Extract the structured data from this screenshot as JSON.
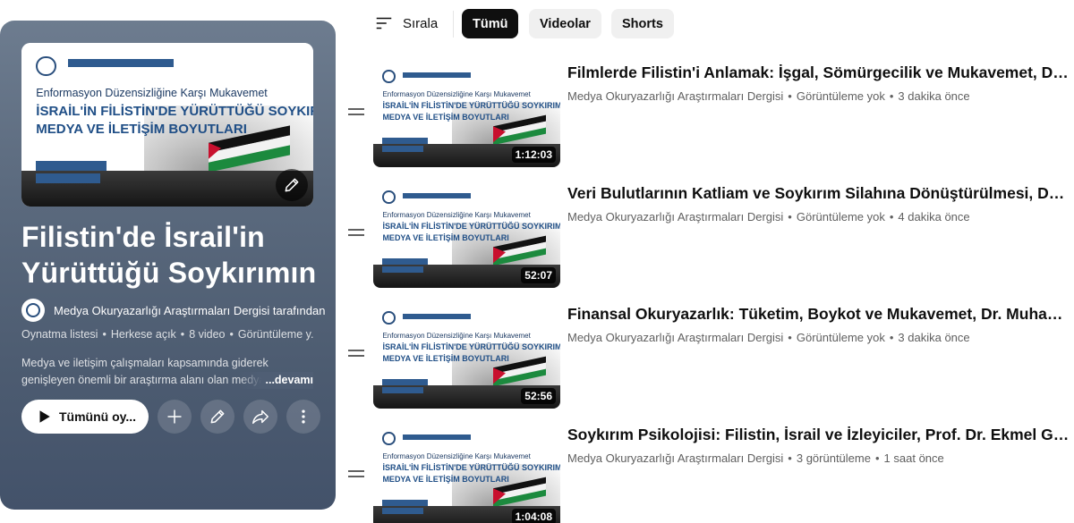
{
  "filter_bar": {
    "sort_label": "Sırala",
    "chips": [
      "Tümü",
      "Videolar",
      "Shorts"
    ],
    "active_chip": "Tümü"
  },
  "playlist": {
    "title_line1": "Filistin'de İsrail'in",
    "title_line2": "Yürüttüğü Soykırımın ...",
    "owner": "Medya Okuryazarlığı Araştırmaları Dergisi tarafından",
    "meta": {
      "type": "Oynatma listesi",
      "visibility": "Herkese açık",
      "count": "8 video",
      "views": "Görüntüleme y..."
    },
    "description_line1": "Medya ve iletişim çalışmaları kapsamında giderek",
    "description_line2": "genişleyen önemli bir araştırma alanı olan medya",
    "description_more": "...devamı",
    "play_all_label": "Tümünü oy..."
  },
  "thumbnail_text": {
    "subtitle": "Enformasyon Düzensizliğine Karşı Mukavemet",
    "headline1": "İSRAİL'İN FİLİSTİN'DE YÜRÜTTÜĞÜ SOYKIRIMIN",
    "headline2": "MEDYA VE İLETİŞİM BOYUTLARI"
  },
  "videos": [
    {
      "title": "Filmlerde Filistin'i Anlamak: İşgal, Sömürgecilik ve Mukavemet, Doç. Dr....",
      "channel": "Medya Okuryazarlığı Araştırmaları Dergisi",
      "views": "Görüntüleme yok",
      "age": "3 dakika önce",
      "duration": "1:12:03"
    },
    {
      "title": "Veri Bulutlarının Katliam ve Soykırım Silahına Dönüştürülmesi, Doç. Dr....",
      "channel": "Medya Okuryazarlığı Araştırmaları Dergisi",
      "views": "Görüntüleme yok",
      "age": "4 dakika önce",
      "duration": "52:07"
    },
    {
      "title": "Finansal Okuryazarlık: Tüketim, Boykot ve Mukavemet, Dr. Muhammed Ak...",
      "channel": "Medya Okuryazarlığı Araştırmaları Dergisi",
      "views": "Görüntüleme yok",
      "age": "3 dakika önce",
      "duration": "52:56"
    },
    {
      "title": "Soykırım Psikolojisi: Filistin, İsrail ve İzleyiciler, Prof. Dr. Ekmel Geçer",
      "channel": "Medya Okuryazarlığı Araştırmaları Dergisi",
      "views": "3 görüntüleme",
      "age": "1 saat önce",
      "duration": "1:04:08"
    }
  ],
  "icons": {
    "sort": "sort-icon",
    "edit": "pencil-icon",
    "play": "play-icon",
    "add": "plus-icon",
    "share": "share-icon",
    "more": "more-vert-icon",
    "drag": "drag-handle-icon"
  },
  "colors": {
    "panel_gradient_top": "#6d7c8f",
    "panel_gradient_bottom": "#43526a",
    "chip_active": "#0f0f0f",
    "chip_inactive": "#f0f0f0",
    "meta_text": "#606060"
  }
}
